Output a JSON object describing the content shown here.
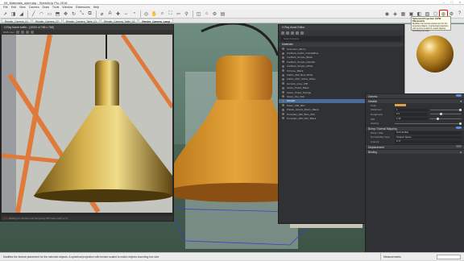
{
  "window": {
    "title": "04_Materials_start.skp - SketchUp Pro 2018",
    "controls": [
      "–",
      "□",
      "×"
    ]
  },
  "menu": [
    "File",
    "Edit",
    "View",
    "Camera",
    "Draw",
    "Tools",
    "Window",
    "Extensions",
    "Help"
  ],
  "toolbar": {
    "left_icons": [
      "select-icon",
      "eraser-icon",
      "paint-icon",
      "line-icon",
      "arc-icon",
      "rectangle-icon",
      "pushpull-icon",
      "move-icon",
      "rotate-icon",
      "scale-icon",
      "offset-icon",
      "tape-icon",
      "text-icon",
      "axes-icon",
      "dimension-icon",
      "protractor-icon",
      "orbit-icon",
      "pan-icon",
      "zoom-icon",
      "zoom-extents-icon",
      "prev-view-icon",
      "walk-icon",
      "section-icon",
      "warehouse-icon",
      "extension-icon",
      "layout-icon"
    ],
    "right_icons": [
      "vray-render-icon",
      "vray-interactive-icon",
      "vray-batch-icon",
      "vray-frame-buffer-icon",
      "vray-asset-editor-icon",
      "uvw-planar-icon",
      "uvw-triplanar-icon",
      "uvw-spherical-icon",
      "vray-settings-icon",
      "vray-help-icon"
    ]
  },
  "tooltip": {
    "title": "Spherical Projection (UVW Placement)",
    "body": "Modifies the texture placement for the selected objects. A spherical projection with texture scaled to match objects bounding box size."
  },
  "scene_tabs": [
    "Render_Camera_01",
    "Render_Camera_02",
    "Render_Camera_Table_01",
    "Render_Camera_Table_02",
    "Render_Camera_Lamp"
  ],
  "active_scene_index": 4,
  "vfb": {
    "title": "V-Ray frame buffer - [100% of 768 x 768]",
    "channel": "RGB color",
    "status": "Waiting for denoise and temporary IRF bake out[1 of 1]...",
    "status_hl": "[0.0]"
  },
  "asset_editor": {
    "title": "V-Ray Asset Editor",
    "search_placeholder": "Search Assets",
    "list_header": "Materials",
    "materials": [
      "Aluminum_Blurry",
      "Carfliant_Fabric_CrinkleBlue",
      "Carfliant_Simple_Black",
      "Carfliant_Simple_Darkflat",
      "Carfliant_Simple_White",
      "Chrome_Black",
      "Fabric_000_Bed_White",
      "Fabric_000_Yellow_White",
      "Generic_Grey_000",
      "Glass_Tinted_Black",
      "Glass_Tinted_Orange",
      "Glass_Ore_000",
      "Metallic",
      "Paper_000_Bird",
      "Plastic_Simple_Blurry_Black",
      "Porcelain_000_Blue_000",
      "Porcelain_000_Wht_Black"
    ],
    "selected_index": 12
  },
  "props": {
    "generic_label": "Generic",
    "metallic_label": "Metallic",
    "fields": [
      {
        "k": "Color",
        "v": ""
      },
      {
        "k": "Metalness",
        "v": "1"
      },
      {
        "k": "Roughness",
        "v": "0.3"
      },
      {
        "k": "IOR",
        "v": "1.56"
      },
      {
        "k": "Opacity",
        "v": ""
      }
    ],
    "bump_label": "Bump / Normal Mapping",
    "bump_fields": [
      {
        "k": "Mode / Map",
        "v": "Normal Map"
      },
      {
        "k": "Normal Map Type",
        "v": "Tangent Space"
      },
      {
        "k": "Amount",
        "v": "0.77"
      }
    ],
    "displacement_label": "Displacement",
    "binding_label": "Binding"
  },
  "status": {
    "message": "Modifies the texture placement for the selected objects. A spherical projection with texture scaled to match objects bounding box size",
    "measurements_label": "Measurements"
  },
  "colors": {
    "accent": "#4a6b96",
    "highlight": "#d11111",
    "metal": "#d8a440"
  }
}
